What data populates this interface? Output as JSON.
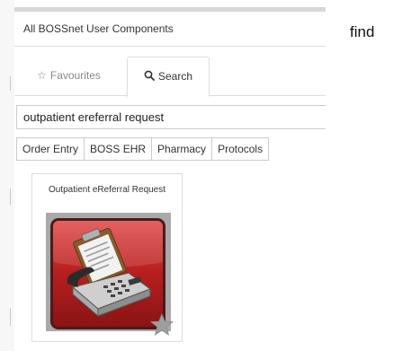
{
  "panel": {
    "title": "All BOSSnet User Components"
  },
  "tabs": [
    {
      "label": "Favourites",
      "icon": "star-outline-icon",
      "icon_glyph": "☆",
      "active": false
    },
    {
      "label": "Search",
      "icon": "search-icon",
      "active": true
    }
  ],
  "search": {
    "value": "outpatient ereferral request"
  },
  "filters": [
    "Order Entry",
    "BOSS EHR",
    "Pharmacy",
    "Protocols"
  ],
  "results": [
    {
      "title": "Outpatient eReferral Request",
      "icon": "clipboard-telephone-icon",
      "favourite_icon": "star-icon"
    }
  ],
  "side_note": "find",
  "colors": {
    "tile_red": "#c62828",
    "tile_border": "#4a1b1b",
    "tile_backdrop": "#a9a9a9",
    "star_gray": "#9e9e9e"
  }
}
